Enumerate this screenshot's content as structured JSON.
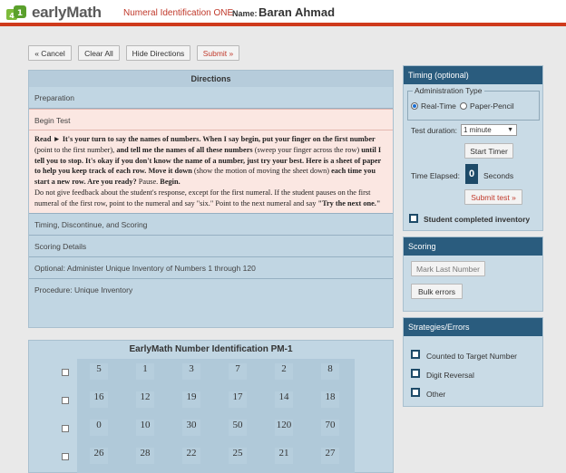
{
  "header": {
    "logo_text": "earlyMath",
    "assessment_title": "Numeral Identification ONE",
    "name_label": "Name:",
    "student_name": "Baran Ahmad"
  },
  "toolbar": {
    "cancel": "« Cancel",
    "clear_all": "Clear All",
    "hide_directions": "Hide Directions",
    "submit": "Submit »"
  },
  "directions": {
    "title": "Directions",
    "sections": [
      "Preparation",
      "Begin Test",
      "Timing, Discontinue, and Scoring",
      "Scoring Details",
      "Optional: Administer Unique Inventory of Numbers 1 through 120",
      "Procedure: Unique Inventory"
    ],
    "script": {
      "read_label": "Read ►",
      "p1": "It's your turn to say the names of numbers. When I say begin, put your finger on the first number",
      "p1b": "(point to the first number),",
      "p2": "and tell me the names of all these numbers",
      "p2b": "(sweep your finger across the row)",
      "p3": "until I tell you to stop. It's okay if you don't know the name of a number, just try your best. Here is a sheet of paper to help you keep track of each row. Move it down",
      "p3b": "(show the motion of moving the sheet down)",
      "p4": "each time you start a new row. Are you ready?",
      "p4b": "Pause.",
      "p5": "Begin.",
      "note": "Do not give feedback about the student's response, except for the first numeral. If the student pauses on the first numeral of the first row, point to the numeral and say \"six.\" Point to the next numeral and say",
      "note_end": "\"Try the next one.\""
    }
  },
  "timing": {
    "title": "Timing (optional)",
    "admin_type_label": "Administration Type",
    "realtime_label": "Real-Time",
    "paper_label": "Paper-Pencil",
    "duration_label": "Test duration:",
    "duration_value": "1 minute",
    "start_timer": "Start Timer",
    "elapsed_label": "Time Elapsed:",
    "elapsed_value": "0",
    "seconds_label": "Seconds",
    "submit_test": "Submit test »",
    "completed_inventory": "Student completed inventory"
  },
  "scoring": {
    "title": "Scoring",
    "mark_last": "Mark Last Number",
    "bulk_errors": "Bulk errors"
  },
  "strategies": {
    "title": "Strategies/Errors",
    "items": [
      "Counted to Target Number",
      "Digit Reversal",
      "Other"
    ]
  },
  "grid": {
    "title": "EarlyMath Number Identification PM-1",
    "rows": [
      [
        "5",
        "1",
        "3",
        "7",
        "2",
        "8"
      ],
      [
        "16",
        "12",
        "19",
        "17",
        "14",
        "18"
      ],
      [
        "0",
        "10",
        "30",
        "50",
        "120",
        "70"
      ],
      [
        "26",
        "28",
        "22",
        "25",
        "21",
        "27"
      ]
    ]
  }
}
